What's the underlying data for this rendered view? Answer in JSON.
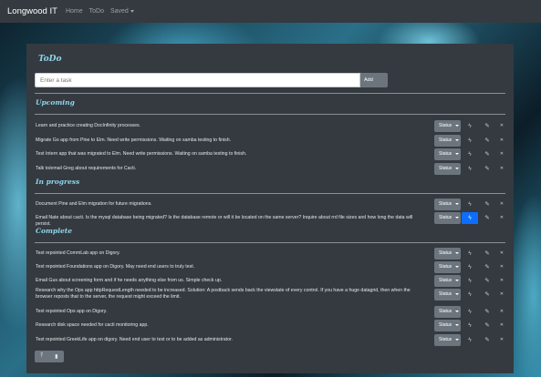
{
  "navbar": {
    "brand": "Longwood IT",
    "links": [
      "Home",
      "ToDo"
    ],
    "dropdown": "Saved"
  },
  "todo": {
    "title": "ToDo",
    "input_placeholder": "Enter a task",
    "add_label": "Add"
  },
  "labels": {
    "status": "Status"
  },
  "sections": [
    {
      "title": "Upcoming",
      "items": [
        "Learn and practice creating DocInfinity processes.",
        "Migrate Go app from Pine to Elm. Need write permissions. Waiting on samba testing to finish.",
        "Test Intern app that was migrated to Elm. Need write permissions. Waiting on samba testing to finish.",
        "Talk to/email Greg about requirements for Cacti."
      ]
    },
    {
      "title": "In progress",
      "items": [
        "Document Pine and Elm migration for future migrations.",
        "Email Nate about cacti. Is the mysql database being migrated? Is the database remote or will it be located on the same server? Inquire about rrd file sizes and how long the data will persist."
      ]
    },
    {
      "title": "Complete",
      "items": [
        "Test repointed CommLab app on Digory.",
        "Test repointed Foundations app on Digory. May need end users to truly test.",
        "Email Gus about screening form and if he needs anything else from us. Simple check up.",
        "Research why the Ops app httpRequestLength needed to be increased. Solution: A postback sends back the viewstate of every control. If you have a huge datagrid, then when the browser reposts that to the server, the request might exceed the limit.",
        "Test repointed Ops app on Digory.",
        "Research disk space needed for cacti monitoring app.",
        "Test repointed GreekLife app on digory. Need end user to test or to be added as administrator."
      ]
    }
  ],
  "active_item": "Email Nate about cacti.",
  "colors": {
    "accent": "#0d6efd",
    "heading": "#8fd6ea",
    "panel": "#343a40"
  }
}
